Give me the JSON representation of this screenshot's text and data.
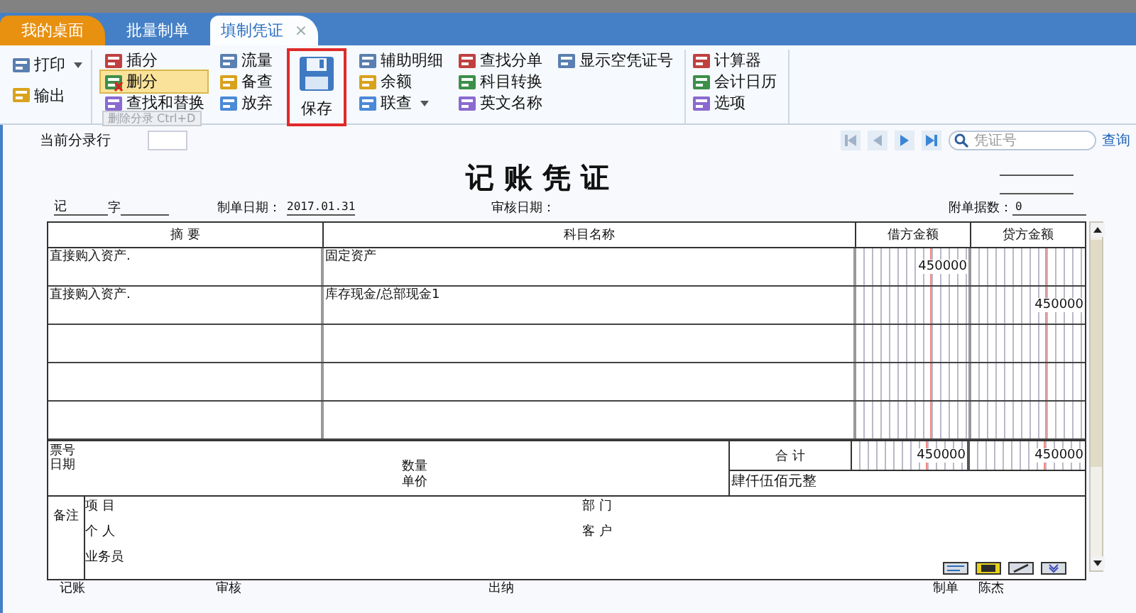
{
  "tabs": [
    {
      "label": "我的桌面",
      "kind": "home",
      "selected": false
    },
    {
      "label": "批量制单",
      "kind": "tab",
      "selected": false
    },
    {
      "label": "填制凭证",
      "kind": "tab",
      "selected": true,
      "close": "×"
    }
  ],
  "toolbar": {
    "groups": [
      {
        "kind": "small",
        "items": [
          {
            "label": "打印",
            "hovered": false,
            "dropdown": true
          },
          {
            "label": "输出",
            "hovered": false,
            "dropdown": false
          }
        ]
      },
      {
        "kind": "small",
        "items": [
          {
            "label": "插分",
            "hovered": false,
            "dropdown": false
          },
          {
            "label": "删分",
            "hovered": true,
            "dropdown": false
          },
          {
            "label": "查找和替换",
            "hovered": false,
            "dropdown": false
          }
        ]
      },
      {
        "kind": "small",
        "items": [
          {
            "label": "流量",
            "hovered": false,
            "dropdown": false
          },
          {
            "label": "备查",
            "hovered": false,
            "dropdown": false
          },
          {
            "label": "放弃",
            "hovered": false,
            "dropdown": false
          }
        ]
      },
      {
        "kind": "large",
        "items": [
          {
            "label": "保存",
            "outlined": true
          }
        ]
      },
      {
        "kind": "small",
        "items": [
          {
            "label": "辅助明细",
            "hovered": false,
            "dropdown": false
          },
          {
            "label": "余额",
            "hovered": false,
            "dropdown": false
          },
          {
            "label": "联查",
            "hovered": false,
            "dropdown": true
          }
        ]
      },
      {
        "kind": "small",
        "items": [
          {
            "label": "查找分单",
            "hovered": false,
            "dropdown": false
          },
          {
            "label": "科目转换",
            "hovered": false,
            "dropdown": false
          },
          {
            "label": "英文名称",
            "hovered": false,
            "dropdown": false
          }
        ]
      },
      {
        "kind": "small",
        "items": [
          {
            "label": "显示空凭证号",
            "hovered": false,
            "dropdown": false
          }
        ]
      },
      {
        "kind": "small",
        "items": [
          {
            "label": "计算器",
            "hovered": false,
            "dropdown": false
          },
          {
            "label": "会计日历",
            "hovered": false,
            "dropdown": false
          },
          {
            "label": "选项",
            "hovered": false,
            "dropdown": false
          }
        ]
      }
    ],
    "tooltip": "删除分录 Ctrl+D"
  },
  "subbar": {
    "row_label": "当前分录行",
    "search_placeholder": "凭证号",
    "search_button": "查询"
  },
  "voucher": {
    "title": "记 账 凭 证",
    "type_label": "记",
    "word_label": "字",
    "date_label": "制单日期：",
    "date": "2017.01.31",
    "audit_label": "审核日期：",
    "attachments_label": "附单据数：",
    "attachments": "0",
    "columns": [
      "摘 要",
      "科目名称",
      "借方金额",
      "贷方金额"
    ],
    "rows": [
      {
        "summary": "直接购入资产.",
        "account": "固定资产",
        "debit": "450000"
      },
      {
        "summary": "直接购入资产.",
        "account": "库存现金/总部现金1",
        "credit": "450000"
      }
    ],
    "ticket_label": "票号",
    "date2_label": "日期",
    "qty_label": "数量",
    "price_label": "单价",
    "total_label": "合 计",
    "total_debit": "450000",
    "total_credit": "450000",
    "amount_words": "肆仟伍佰元整",
    "notes_label": "备注",
    "notes_left": [
      "项 目",
      "个 人",
      "业务员"
    ],
    "notes_right": [
      "部 门",
      "客 户"
    ]
  },
  "footer": [
    {
      "label": "记账"
    },
    {
      "label": "审核"
    },
    {
      "label": "出纳"
    },
    {
      "label": "制单",
      "value": "陈杰"
    }
  ]
}
